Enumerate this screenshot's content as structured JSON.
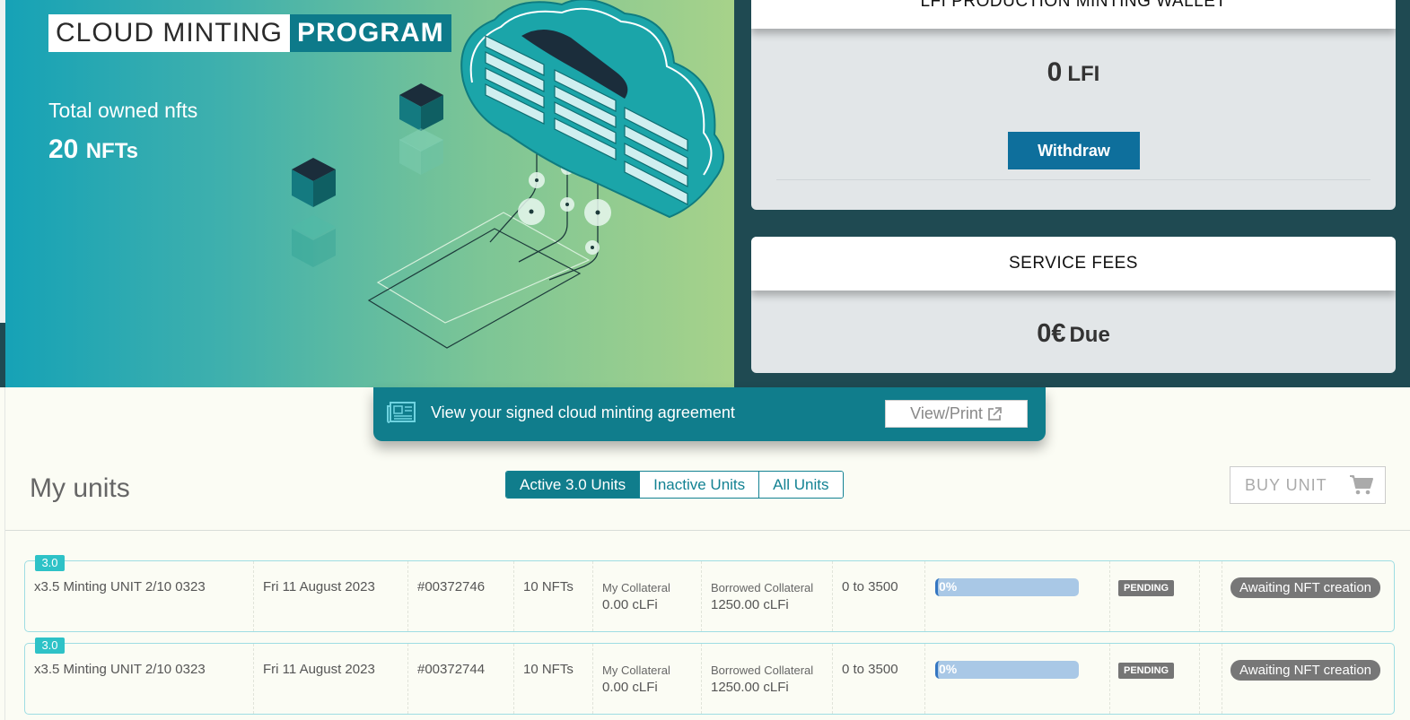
{
  "hero": {
    "title_light": "CLOUD MINTING",
    "title_bold": "PROGRAM",
    "owned_label": "Total owned nfts",
    "owned_value": "20",
    "owned_unit": "NFTs"
  },
  "wallet": {
    "title": "LFI PRODUCTION MINTING WALLET",
    "amount": "0",
    "currency": "LFI",
    "withdraw_label": "Withdraw"
  },
  "fees": {
    "title": "SERVICE FEES",
    "amount": "0€",
    "suffix": "Due"
  },
  "agreement": {
    "text": "View your signed cloud minting agreement",
    "button_label": "View/Print"
  },
  "units": {
    "title": "My units",
    "tabs": [
      {
        "label": "Active 3.0 Units",
        "active": true
      },
      {
        "label": "Inactive Units",
        "active": false
      },
      {
        "label": "All Units",
        "active": false
      }
    ],
    "buy_label": "BUY UNIT",
    "rows": [
      {
        "badge": "3.0",
        "name": "x3.5 Minting UNIT 2/10 0323",
        "date": "Fri 11 August 2023",
        "id": "#00372746",
        "nfts": "10 NFTs",
        "my_collateral_label": "My Collateral",
        "my_collateral_value": "0.00 cLFi",
        "borrowed_label": "Borrowed Collateral",
        "borrowed_value": "1250.00 cLFi",
        "range": "0 to 3500",
        "progress": "0%",
        "status": "PENDING",
        "state": "Awaiting NFT creation"
      },
      {
        "badge": "3.0",
        "name": "x3.5 Minting UNIT 2/10 0323",
        "date": "Fri 11 August 2023",
        "id": "#00372744",
        "nfts": "10 NFTs",
        "my_collateral_label": "My Collateral",
        "my_collateral_value": "0.00 cLFi",
        "borrowed_label": "Borrowed Collateral",
        "borrowed_value": "1250.00 cLFi",
        "range": "0 to 3500",
        "progress": "0%",
        "status": "PENDING",
        "state": "Awaiting NFT creation"
      }
    ]
  },
  "colors": {
    "teal": "#107d8c",
    "accent": "#2ec2c7",
    "button_blue": "#0e6f9c",
    "progress_blue": "#a9c8e6"
  },
  "icons": [
    "cloud-server-illustration",
    "cube-icon",
    "document-icon",
    "external-link-icon",
    "cart-icon"
  ]
}
